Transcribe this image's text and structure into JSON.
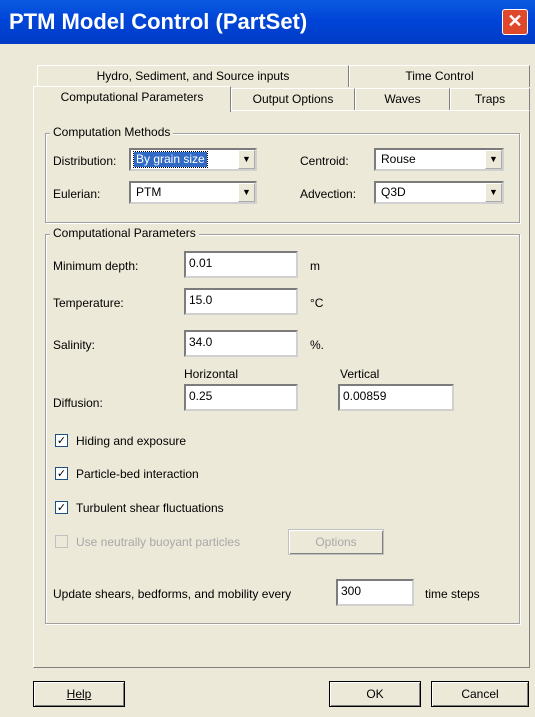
{
  "window": {
    "title": "PTM Model Control (PartSet)",
    "close_glyph": "✕"
  },
  "tabs": {
    "row1": [
      "Hydro, Sediment, and Source inputs",
      "Time Control"
    ],
    "row2": [
      "Computational Parameters",
      "Output Options",
      "Waves",
      "Traps"
    ],
    "active": "Computational Parameters"
  },
  "methods": {
    "group_title": "Computation Methods",
    "distribution_label": "Distribution:",
    "distribution_value": "By grain size",
    "centroid_label": "Centroid:",
    "centroid_value": "Rouse",
    "eulerian_label": "Eulerian:",
    "eulerian_value": "PTM",
    "advection_label": "Advection:",
    "advection_value": "Q3D"
  },
  "params": {
    "group_title": "Computational Parameters",
    "min_depth_label": "Minimum depth:",
    "min_depth_value": "0.01",
    "min_depth_unit": "m",
    "temperature_label": "Temperature:",
    "temperature_value": "15.0",
    "temperature_unit": "°C",
    "salinity_label": "Salinity:",
    "salinity_value": "34.0",
    "salinity_unit": "%.",
    "diffusion_label": "Diffusion:",
    "horizontal_header": "Horizontal",
    "horizontal_value": "0.25",
    "vertical_header": "Vertical",
    "vertical_value": "0.00859",
    "hiding_label": "Hiding and exposure",
    "hiding_checked": true,
    "particle_bed_label": "Particle-bed interaction",
    "particle_bed_checked": true,
    "turbulent_label": "Turbulent shear fluctuations",
    "turbulent_checked": true,
    "buoyant_label": "Use neutrally buoyant particles",
    "buoyant_checked": false,
    "options_button": "Options",
    "update_label": "Update shears, bedforms, and mobility every",
    "update_value": "300",
    "update_unit": "time steps"
  },
  "footer": {
    "help": "Help",
    "ok": "OK",
    "cancel": "Cancel"
  }
}
